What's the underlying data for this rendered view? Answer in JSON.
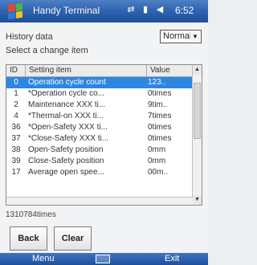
{
  "title_bar": {
    "app_title": "Handy Terminal",
    "icons": [
      "network-icon",
      "signal-icon",
      "volume-icon"
    ],
    "time": "6:52"
  },
  "form": {
    "history_label": "History data",
    "mode_value": "Normal",
    "select_label": "Select a change item"
  },
  "table": {
    "columns": [
      "ID",
      "Setting item",
      "Value"
    ],
    "rows": [
      {
        "id": "0",
        "item": "Operation cycle count",
        "value": "123..",
        "selected": true
      },
      {
        "id": "1",
        "item": "*Operation cycle co...",
        "value": "0times",
        "selected": false
      },
      {
        "id": "2",
        "item": "Maintenance XXX ti...",
        "value": "9tim..",
        "selected": false
      },
      {
        "id": "4",
        "item": "*Thermal-on XXX ti...",
        "value": "7times",
        "selected": false
      },
      {
        "id": "36",
        "item": "*Open-Safety XXX ti...",
        "value": "0times",
        "selected": false
      },
      {
        "id": "37",
        "item": "*Close-Safety XXX ti...",
        "value": "0times",
        "selected": false
      },
      {
        "id": "38",
        "item": "Open-Safety position",
        "value": "0mm",
        "selected": false
      },
      {
        "id": "39",
        "item": "Close-Safety position",
        "value": "0mm",
        "selected": false
      },
      {
        "id": "17",
        "item": "Average open spee...",
        "value": "00m..",
        "selected": false
      }
    ]
  },
  "status_text": "1310784times",
  "buttons": {
    "back": "Back",
    "clear": "Clear"
  },
  "softkeys": {
    "left": "Menu",
    "right": "Exit"
  },
  "colors": {
    "title_bar": "#3065b3",
    "selection": "#2d86e0"
  }
}
